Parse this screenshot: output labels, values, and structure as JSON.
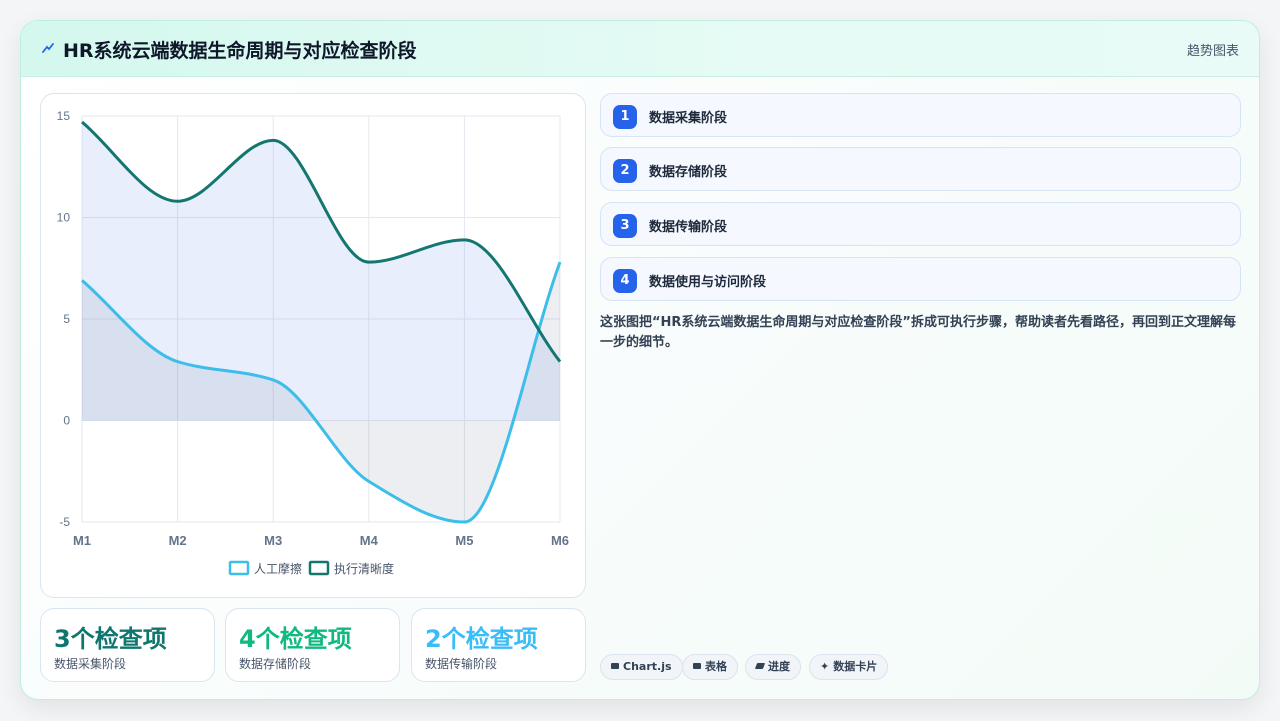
{
  "header": {
    "title": "HR系统云端数据生命周期与对应检查阶段",
    "right_label": "趋势图表",
    "icon": "trend-icon"
  },
  "chart_data": {
    "type": "line",
    "categories": [
      "M1",
      "M2",
      "M3",
      "M4",
      "M5",
      "M6"
    ],
    "ylim": [
      -5,
      15
    ],
    "yticks": [
      -5,
      0,
      5,
      10,
      15
    ],
    "grid": true,
    "legend_position": "bottom",
    "series": [
      {
        "name": "人工摩擦",
        "values": [
          6.9,
          2.9,
          2.0,
          -3.0,
          -5.0,
          7.8
        ],
        "color": "#3dbde9",
        "fill": true
      },
      {
        "name": "执行清晰度",
        "values": [
          14.7,
          10.8,
          13.8,
          7.8,
          8.9,
          2.9
        ],
        "color": "#13766f",
        "fill": true
      }
    ]
  },
  "stats": [
    {
      "value": "3个检查项",
      "label": "数据采集阶段",
      "color": "#0f766e"
    },
    {
      "value": "4个检查项",
      "label": "数据存储阶段",
      "color": "#10b981"
    },
    {
      "value": "2个检查项",
      "label": "数据传输阶段",
      "color": "#38bdf8"
    }
  ],
  "steps": [
    {
      "num": "1",
      "label": "数据采集阶段"
    },
    {
      "num": "2",
      "label": "数据存储阶段"
    },
    {
      "num": "3",
      "label": "数据传输阶段"
    },
    {
      "num": "4",
      "label": "数据使用与访问阶段"
    }
  ],
  "description": "这张图把“HR系统云端数据生命周期与对应检查阶段”拆成可执行步骤，帮助读者先看路径，再回到正文理解每一步的细节。",
  "tags": [
    {
      "label": "Chart.js",
      "icon": "chart-icon"
    },
    {
      "label": "表格",
      "icon": "table-icon"
    },
    {
      "label": "进度",
      "icon": "progress-icon"
    },
    {
      "label": "数据卡片",
      "icon": "sparkle-icon"
    }
  ],
  "colors": {
    "accent": "#2563eb",
    "border": "#bfeee0"
  }
}
